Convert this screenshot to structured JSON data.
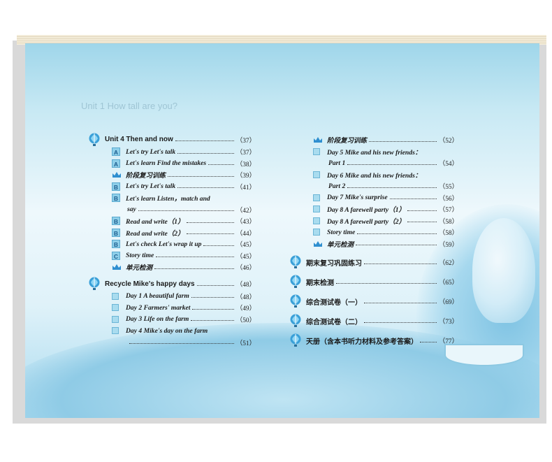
{
  "page": {
    "background_title": "Unit 1  How tall are you?"
  },
  "colors": {
    "accent": "#5aa9cf",
    "badge": "#8fd0ea",
    "balloon": "#3aa0d8"
  },
  "left": {
    "unit4": {
      "label": "Unit 4   Then and now",
      "page": "（37）"
    },
    "unit4_items": [
      {
        "badge": "A",
        "label": "Let's try   Let's talk",
        "page": "（37）"
      },
      {
        "badge": "A",
        "label": "Let's learn   Find the mistakes",
        "page": "（38）"
      },
      {
        "badge": "crown",
        "label": "阶段复习训练",
        "page": "（39）"
      },
      {
        "badge": "B",
        "label": "Let's try   Let's talk",
        "page": "（41）"
      },
      {
        "badge": "B",
        "label": "Let's learn   Listen，match and",
        "page": ""
      },
      {
        "badge": "",
        "label": "say",
        "page": "（42）"
      },
      {
        "badge": "B",
        "label": "Read and write（1）",
        "page": "（43）"
      },
      {
        "badge": "B",
        "label": "Read and write（2）",
        "page": "（44）"
      },
      {
        "badge": "B",
        "label": "Let's check   Let's wrap it up",
        "page": "（45）"
      },
      {
        "badge": "C",
        "label": "Story time",
        "page": "（45）"
      },
      {
        "badge": "crown",
        "label": "单元检测",
        "page": "（46）"
      }
    ],
    "recycle": {
      "label": "Recycle   Mike's happy days",
      "page": "（48）"
    },
    "recycle_items": [
      {
        "label": "Day 1   A beautiful farm",
        "page": "（48）"
      },
      {
        "label": "Day 2   Farmers' market",
        "page": "（49）"
      },
      {
        "label": "Day 3   Life on the farm",
        "page": "（50）"
      },
      {
        "label": "Day 4   Mike's day on the farm",
        "page": ""
      },
      {
        "label": "",
        "page": "（51）"
      }
    ]
  },
  "right": {
    "items": [
      {
        "type": "crown",
        "label": "阶段复习训练",
        "page": "（52）"
      },
      {
        "type": "sq",
        "label": "Day 5   Mike and his new friends：",
        "page": ""
      },
      {
        "type": "",
        "label": "Part 1",
        "page": "（54）"
      },
      {
        "type": "sq",
        "label": "Day 6   Mike and his new friends：",
        "page": ""
      },
      {
        "type": "",
        "label": "Part 2",
        "page": "（55）"
      },
      {
        "type": "sq",
        "label": "Day 7   Mike's surprise",
        "page": "（56）"
      },
      {
        "type": "sq",
        "label": "Day 8   A farewell party（1）",
        "page": "（57）"
      },
      {
        "type": "sq",
        "label": "Day 8   A farewell party（2）",
        "page": "（58）"
      },
      {
        "type": "sq",
        "label": "Story time",
        "page": "（58）"
      },
      {
        "type": "crown",
        "label": "单元检测",
        "page": "（59）"
      }
    ],
    "sections": [
      {
        "label": "期末复习巩固练习",
        "page": "（62）"
      },
      {
        "label": "期末检测",
        "page": "（65）"
      },
      {
        "label": "综合测试卷（一）",
        "page": "（69）"
      },
      {
        "label": "综合测试卷（二）",
        "page": "（73）"
      },
      {
        "label": "天册（含本书听力材料及参考答案）",
        "page": "（77）"
      }
    ]
  }
}
